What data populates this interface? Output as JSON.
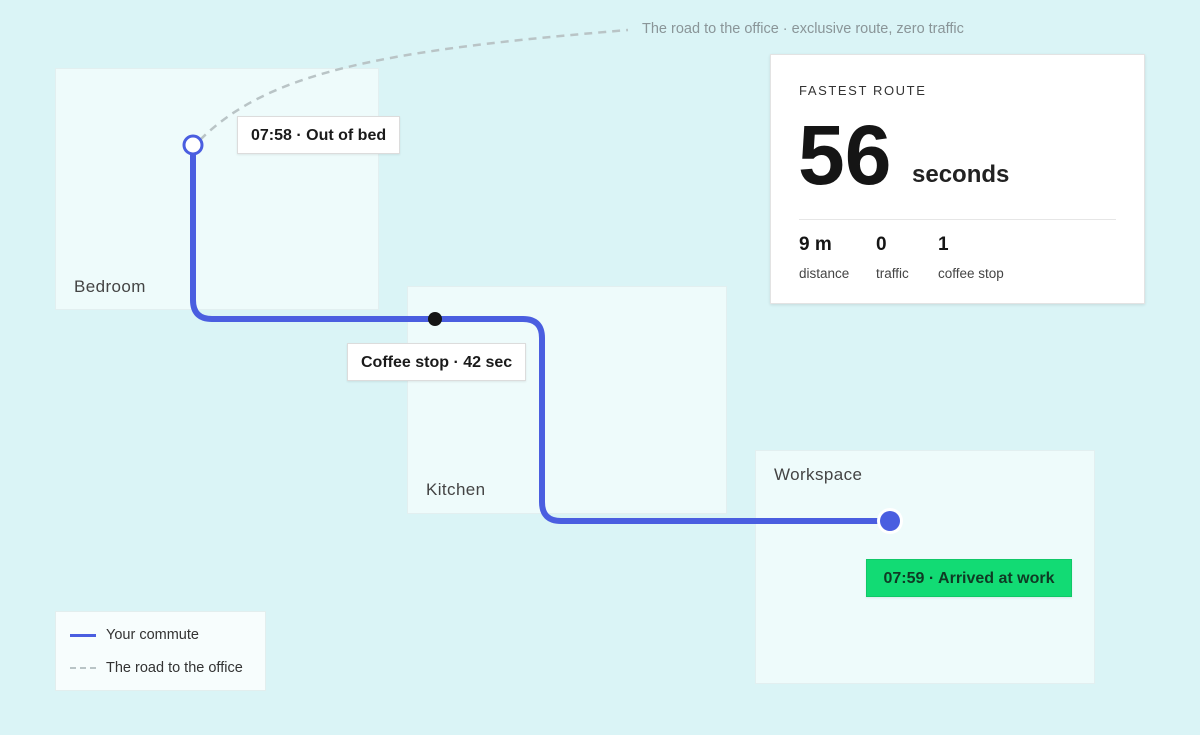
{
  "header": {
    "note": "The road to the office · exclusive route, zero traffic"
  },
  "map": {
    "rooms": [
      {
        "id": "bedroom",
        "label": "Bedroom"
      },
      {
        "id": "kitchen",
        "label": "Kitchen"
      },
      {
        "id": "workspace",
        "label": "Workspace"
      }
    ],
    "events": {
      "start": "07:58 · Out of bed",
      "stop": "Coffee stop · 42 sec",
      "end": "07:59 · Arrived at work"
    }
  },
  "summary": {
    "title": "FASTEST ROUTE",
    "value": "56",
    "unit": "seconds",
    "stats": [
      {
        "value": "9 m",
        "label": "distance"
      },
      {
        "value": "0",
        "label": "traffic"
      },
      {
        "value": "1",
        "label": "coffee stop"
      }
    ]
  },
  "legend": {
    "items": [
      {
        "label": "Your commute",
        "style": "solid"
      },
      {
        "label": "The road to the office",
        "style": "dashed"
      }
    ]
  },
  "colors": {
    "background": "#daf4f6",
    "route": "#4a5ee0",
    "arrived": "#12db74",
    "road": "#b9c4c6"
  }
}
